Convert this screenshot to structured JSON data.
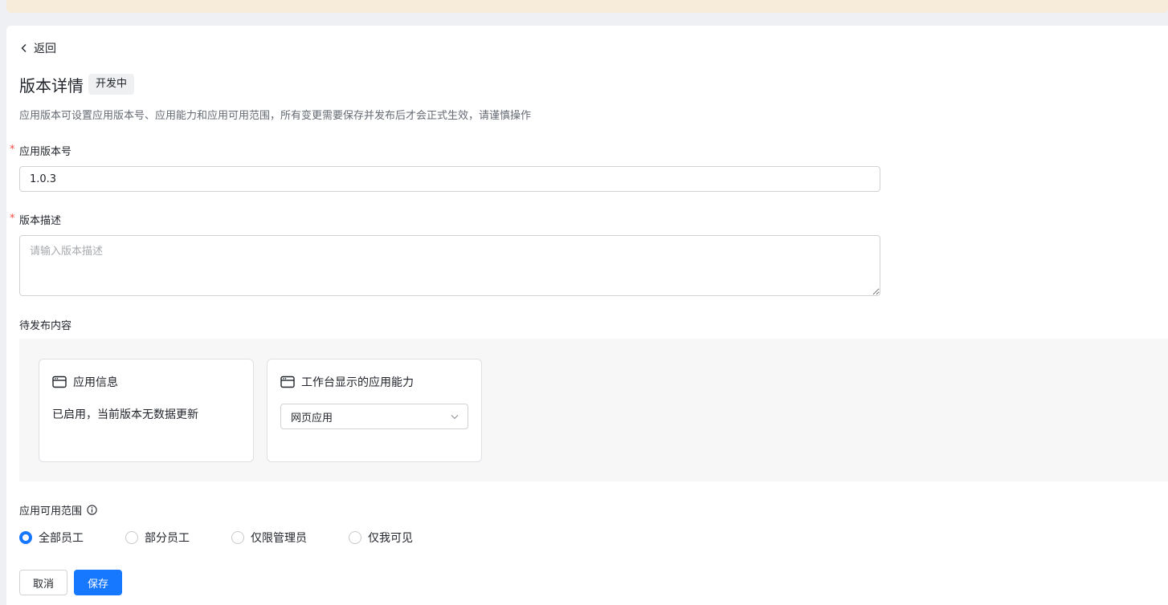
{
  "header": {
    "back_label": "返回",
    "title": "版本详情",
    "status_badge": "开发中",
    "description": "应用版本可设置应用版本号、应用能力和应用可用范围，所有变更需要保存并发布后才会正式生效，请谨慎操作"
  },
  "form": {
    "version": {
      "label": "应用版本号",
      "required_mark": "*",
      "value": "1.0.3"
    },
    "description": {
      "label": "版本描述",
      "required_mark": "*",
      "placeholder": "请输入版本描述",
      "value": ""
    }
  },
  "pending": {
    "label": "待发布内容",
    "cards": [
      {
        "title": "应用信息",
        "icon": "window-icon",
        "body": "已启用，当前版本无数据更新"
      },
      {
        "title": "工作台显示的应用能力",
        "icon": "window-icon",
        "select_value": "网页应用"
      }
    ]
  },
  "scope": {
    "label": "应用可用范围",
    "info_icon": "info-icon",
    "selected": "全部员工",
    "options": [
      "全部员工",
      "部分员工",
      "仅限管理员",
      "仅我可见"
    ]
  },
  "actions": {
    "cancel_label": "取消",
    "save_label": "保存"
  },
  "colors": {
    "primary": "#1677ff",
    "required": "#f54a45",
    "notice": "#f7ebd9"
  }
}
